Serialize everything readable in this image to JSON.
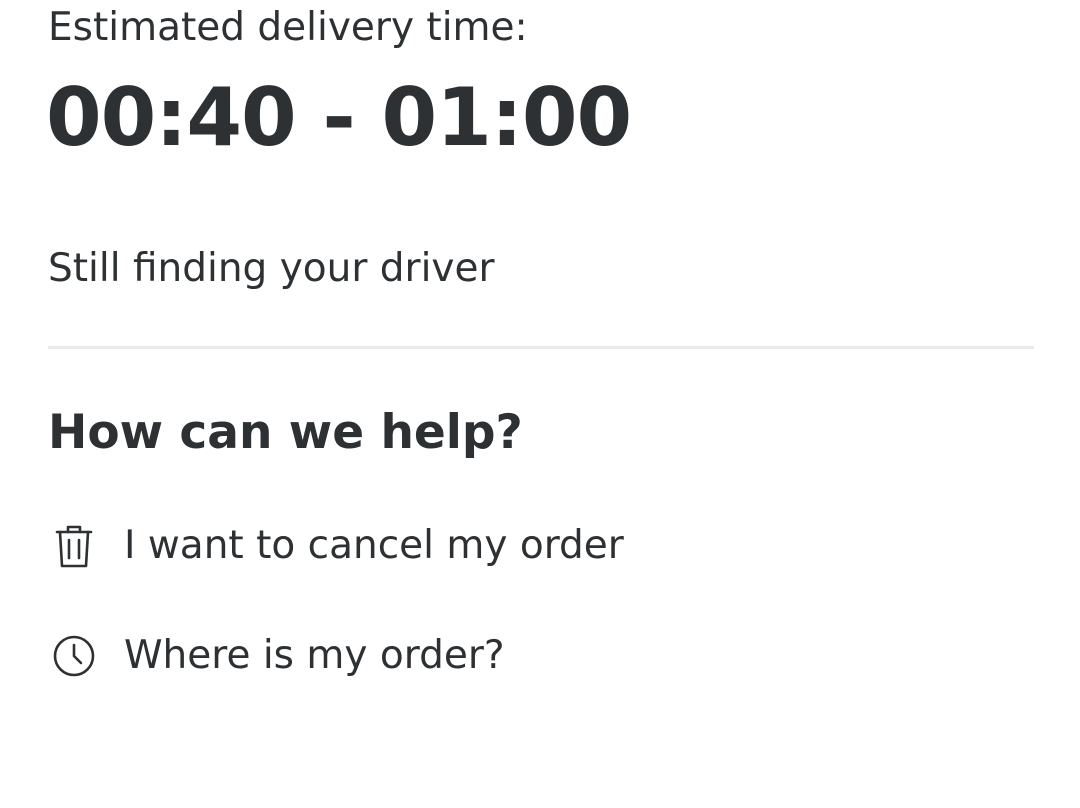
{
  "delivery": {
    "estimate_label": "Estimated delivery time:",
    "eta_range": "00:40 - 01:00",
    "driver_status": "Still finding your driver"
  },
  "help": {
    "title": "How can we help?",
    "options": [
      {
        "label": "I want to cancel my order",
        "icon": "trash-icon"
      },
      {
        "label": "Where is my order?",
        "icon": "clock-icon"
      }
    ]
  },
  "colors": {
    "text": "#2d3133",
    "divider": "#e8eaeb",
    "background": "#ffffff"
  }
}
